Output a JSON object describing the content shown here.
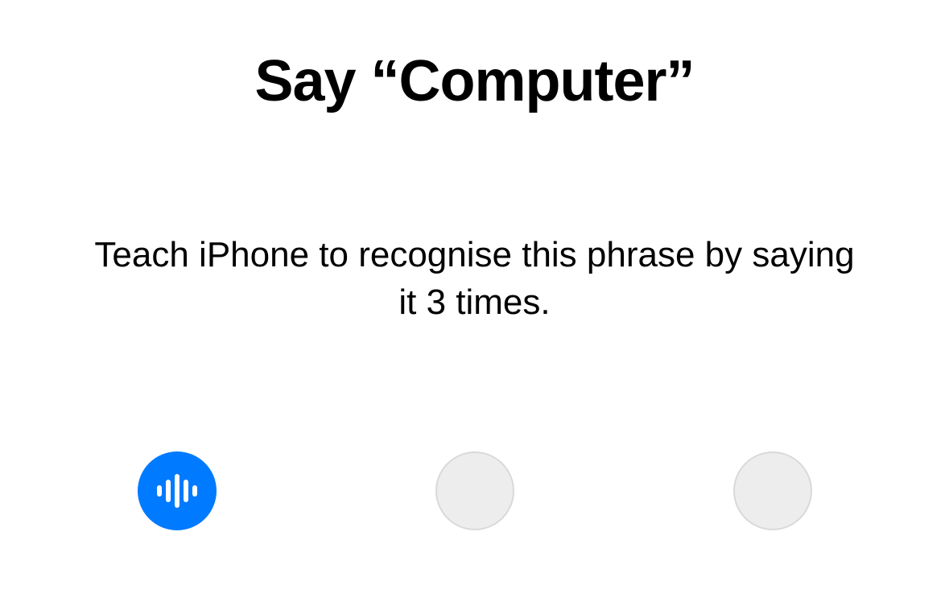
{
  "title": "Say “Computer”",
  "subtitle": "Teach iPhone to recognise this phrase by saying it 3 times.",
  "colors": {
    "accent": "#007AFF",
    "inactive_fill": "#EDEDED",
    "inactive_border": "#D9D9D9"
  },
  "progress": {
    "total": 3,
    "current": 1
  }
}
